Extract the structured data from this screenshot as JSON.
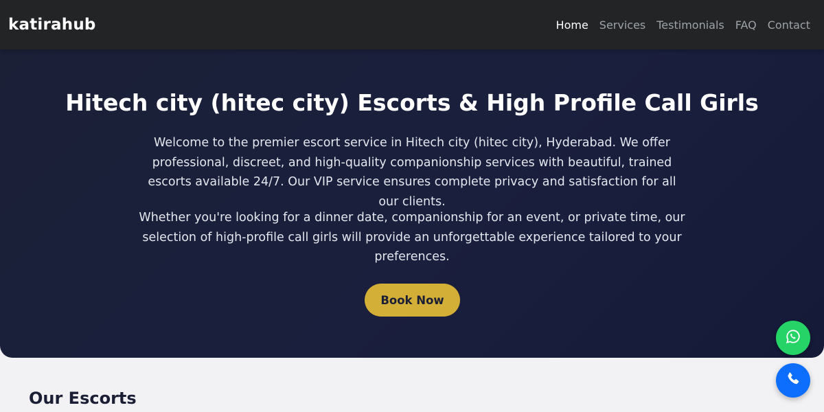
{
  "nav": {
    "brand": "katirahub",
    "links": [
      "Home",
      "Services",
      "Testimonials",
      "FAQ",
      "Contact"
    ],
    "active": "Home"
  },
  "hero": {
    "title": "Hitech city (hitec city) Escorts & High Profile Call Girls",
    "paragraph1": "Welcome to the premier escort service in Hitech city (hitec city), Hyderabad. We offer professional, discreet, and high-quality companionship services with beautiful, trained escorts available 24/7. Our VIP service ensures complete privacy and satisfaction for all our clients.",
    "paragraph2": "Whether you're looking for a dinner date, companionship for an event, or private time, our selection of high-profile call girls will provide an unforgettable experience tailored to your preferences.",
    "button_label": "Book Now"
  },
  "section": {
    "title": "Our Escorts"
  },
  "floating": {
    "whatsapp_icon": "whatsapp-icon",
    "phone_icon": "phone-icon"
  },
  "colors": {
    "navbar_bg": "#222426",
    "hero_bg": "#1a1f3d",
    "accent_gold": "#d4af37",
    "whatsapp_green": "#25d366",
    "phone_blue": "#0d6efd"
  }
}
